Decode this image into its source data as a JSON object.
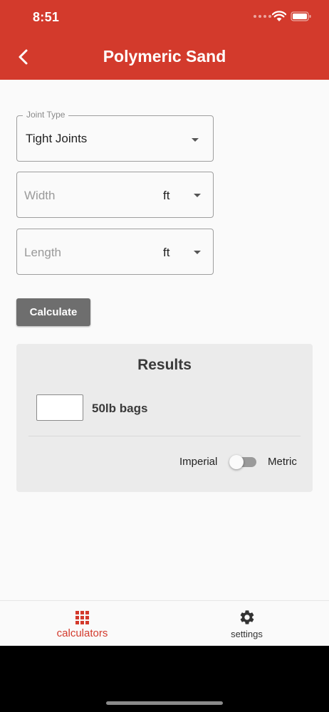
{
  "status_bar": {
    "time": "8:51"
  },
  "app_bar": {
    "title": "Polymeric Sand"
  },
  "form": {
    "joint_type": {
      "label": "Joint Type",
      "value": "Tight Joints"
    },
    "width": {
      "placeholder": "Width",
      "unit": "ft"
    },
    "length": {
      "placeholder": "Length",
      "unit": "ft"
    },
    "calculate_label": "Calculate"
  },
  "results": {
    "title": "Results",
    "value": "",
    "unit_label": "50lb bags",
    "toggle": {
      "left_label": "Imperial",
      "right_label": "Metric",
      "state": "Imperial"
    }
  },
  "bottom_nav": {
    "items": [
      {
        "label": "calculators",
        "icon": "grid-icon",
        "active": true
      },
      {
        "label": "settings",
        "icon": "gear-icon",
        "active": false
      }
    ]
  },
  "colors": {
    "accent": "#d33a2c",
    "button": "#6e6e6e",
    "card": "#ebebeb"
  }
}
